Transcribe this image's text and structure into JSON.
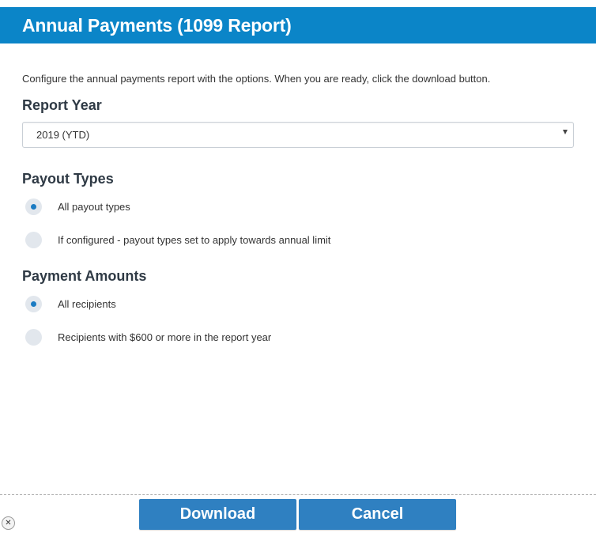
{
  "dialog": {
    "title": "Annual Payments (1099 Report)",
    "intro": "Configure the annual payments report with the options. When you are ready, click the download button."
  },
  "report_year": {
    "label": "Report Year",
    "selected": "2019 (YTD)"
  },
  "payout_types": {
    "label": "Payout Types",
    "options": [
      {
        "label": "All payout types",
        "checked": true
      },
      {
        "label": "If configured - payout types set to apply towards annual limit",
        "checked": false
      }
    ]
  },
  "payment_amounts": {
    "label": "Payment Amounts",
    "options": [
      {
        "label": "All recipients",
        "checked": true
      },
      {
        "label": "Recipients with $600 or more in the report year",
        "checked": false
      }
    ]
  },
  "footer": {
    "download_label": "Download",
    "cancel_label": "Cancel",
    "close_glyph": "✕"
  },
  "colors": {
    "header_bg": "#0b85c8",
    "button_bg": "#2f80c1",
    "radio_checked": "#1b7bc2",
    "radio_bg": "#e2e7ed"
  },
  "icons": {
    "select_arrow": "caret-down-icon",
    "close": "close-icon"
  }
}
